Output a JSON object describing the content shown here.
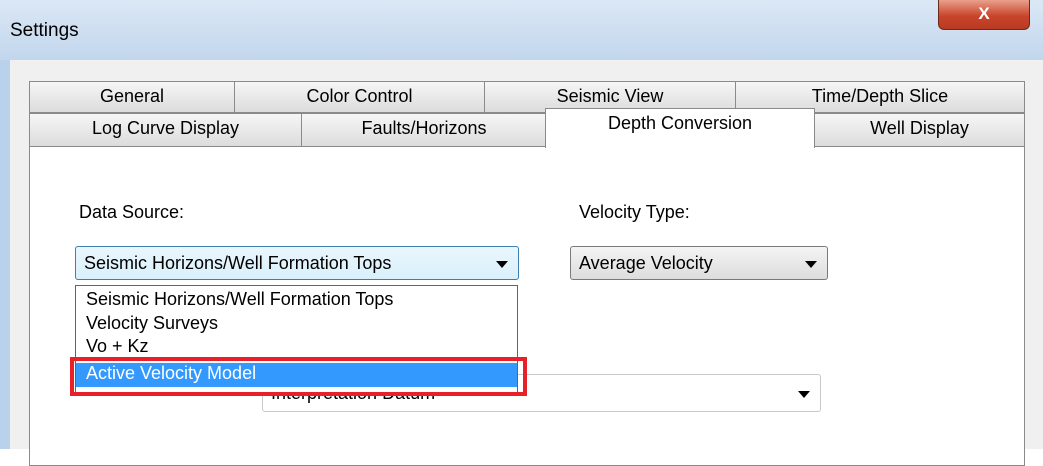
{
  "window": {
    "title": "Settings",
    "close_glyph": "X"
  },
  "tabs_row1": [
    "General",
    "Color Control",
    "Seismic View",
    "Time/Depth Slice"
  ],
  "tabs_row2": [
    "Log Curve Display",
    "Faults/Horizons",
    "Depth Conversion",
    "Well Display"
  ],
  "active_tab": "Depth Conversion",
  "data_source": {
    "label": "Data Source:",
    "value": "Seismic Horizons/Well Formation Tops",
    "options": [
      "Seismic Horizons/Well Formation Tops",
      "Velocity Surveys",
      "Vo + Kz",
      "Active Velocity Model"
    ],
    "highlighted_option": "Active Velocity Model"
  },
  "velocity_type": {
    "label": "Velocity Type:",
    "value": "Average Velocity"
  },
  "datum": {
    "value": "Interpretation Datum"
  },
  "colors": {
    "highlight": "#3399ff",
    "annotation_box": "#e8202a",
    "close_button": "#c8452b"
  }
}
